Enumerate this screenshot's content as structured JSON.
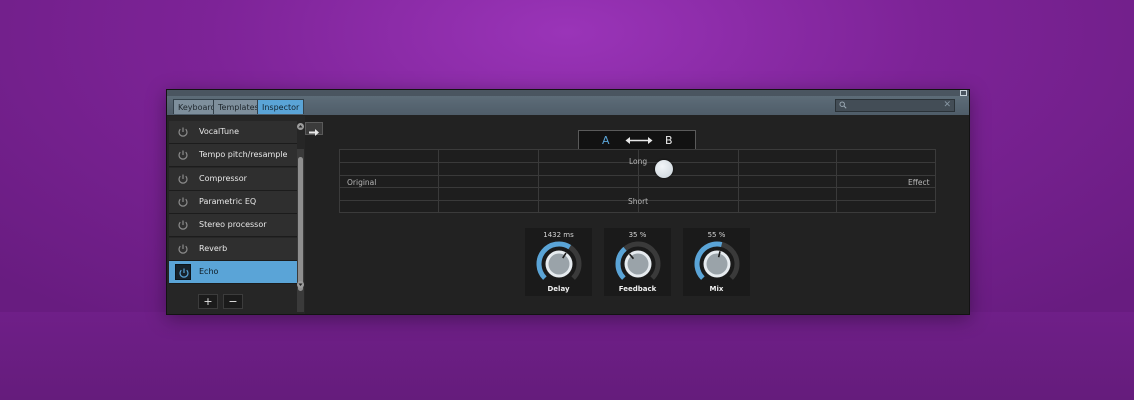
{
  "tabs": [
    {
      "label": "Keyboard",
      "active": false
    },
    {
      "label": "Templates",
      "active": false
    },
    {
      "label": "Inspector",
      "active": true
    }
  ],
  "search": {
    "placeholder": "",
    "value": ""
  },
  "effects": [
    {
      "label": "VocalTune",
      "selected": false
    },
    {
      "label": "Tempo pitch/resample",
      "selected": false
    },
    {
      "label": "Compressor",
      "selected": false
    },
    {
      "label": "Parametric EQ",
      "selected": false
    },
    {
      "label": "Stereo processor",
      "selected": false
    },
    {
      "label": "Reverb",
      "selected": false
    },
    {
      "label": "Echo",
      "selected": true
    }
  ],
  "list_buttons": {
    "add": "+",
    "remove": "−"
  },
  "ab_switch": {
    "a": "A",
    "b": "B"
  },
  "xy_pad": {
    "top": "Long",
    "bottom": "Short",
    "left": "Original",
    "right": "Effect"
  },
  "knobs": [
    {
      "label": "Delay",
      "value": "1432 ms",
      "fraction": 0.62
    },
    {
      "label": "Feedback",
      "value": "35 %",
      "fraction": 0.35
    },
    {
      "label": "Mix",
      "value": "55 %",
      "fraction": 0.55
    }
  ],
  "colors": {
    "accent": "#5aa4d7",
    "background": "#7d2397"
  }
}
